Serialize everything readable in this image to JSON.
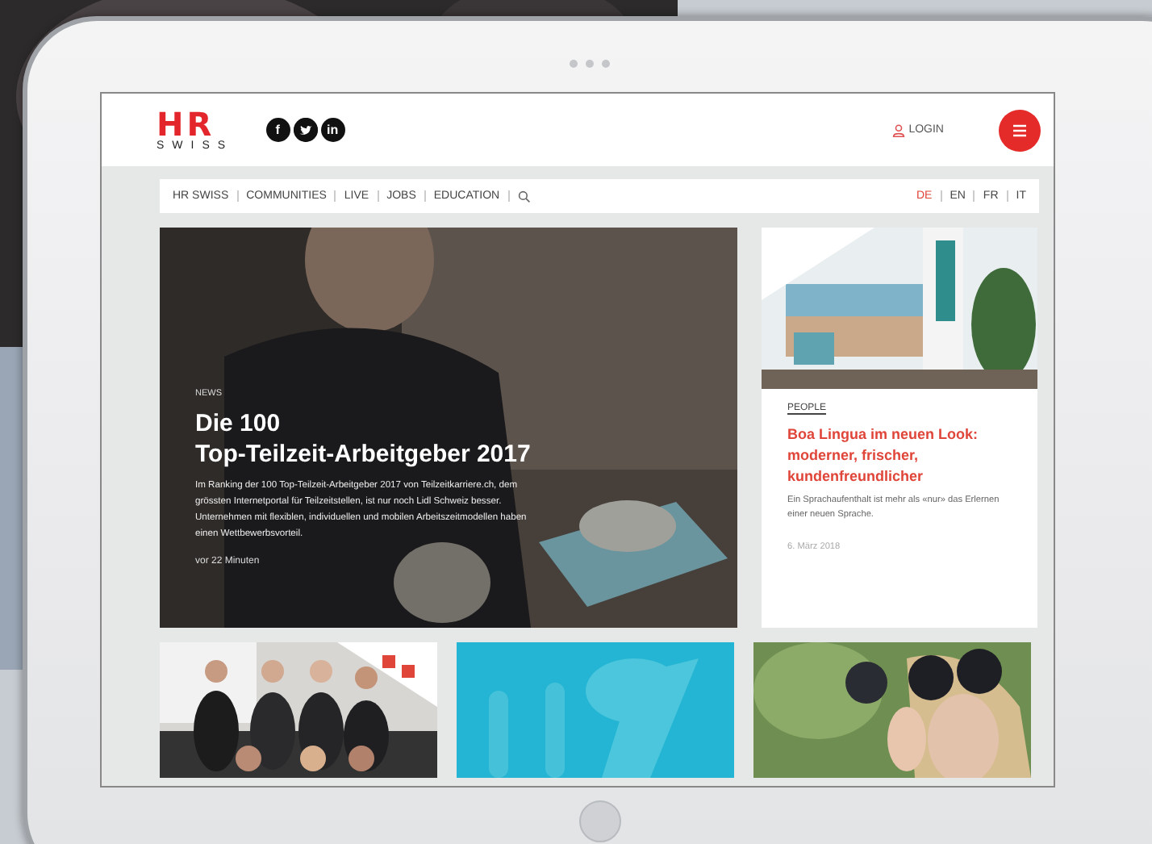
{
  "site": {
    "logo_mark": "HR",
    "logo_word": "SWISS",
    "social": [
      {
        "kind": "letter",
        "glyph": "f"
      },
      {
        "kind": "bird"
      },
      {
        "kind": "letter",
        "glyph": "in"
      }
    ],
    "login": "LOGIN"
  },
  "nav": {
    "items": [
      "HR SWISS",
      "COMMUNITIES",
      "LIVE",
      "JOBS",
      "EDUCATION"
    ],
    "languages": [
      {
        "label": "DE",
        "selected": true
      },
      {
        "label": "EN",
        "selected": false
      },
      {
        "label": "FR",
        "selected": false
      },
      {
        "label": "IT",
        "selected": false
      }
    ]
  },
  "hero": {
    "tag": "NEWS",
    "title_lines": [
      "Die 100",
      "Top-Teilzeit-Arbeitgeber 2017"
    ],
    "body": "Im Ranking der 100 Top-Teilzeit-Arbeitgeber 2017 von Teilzeitkarriere.ch, dem grössten Internetportal für Teilzeitstellen, ist nur noch Lidl Schweiz besser. Unternehmen mit flexiblen, individuellen und mobilen Arbeitszeitmodellen haben einen Wettbewerbsvorteil.",
    "time": "vor 22 Minuten"
  },
  "card": {
    "tag": "PEOPLE",
    "title": "Boa Lingua im neuen Look: moderner, frischer, kundenfreundlicher",
    "body": "Ein Sprachaufenthalt ist mehr als «nur» das Erlernen einer neuen Sprache.",
    "date": "6. März 2018"
  },
  "tiles": [
    {
      "kind": "group"
    },
    {
      "kind": "runners"
    },
    {
      "kind": "binoculars"
    }
  ]
}
